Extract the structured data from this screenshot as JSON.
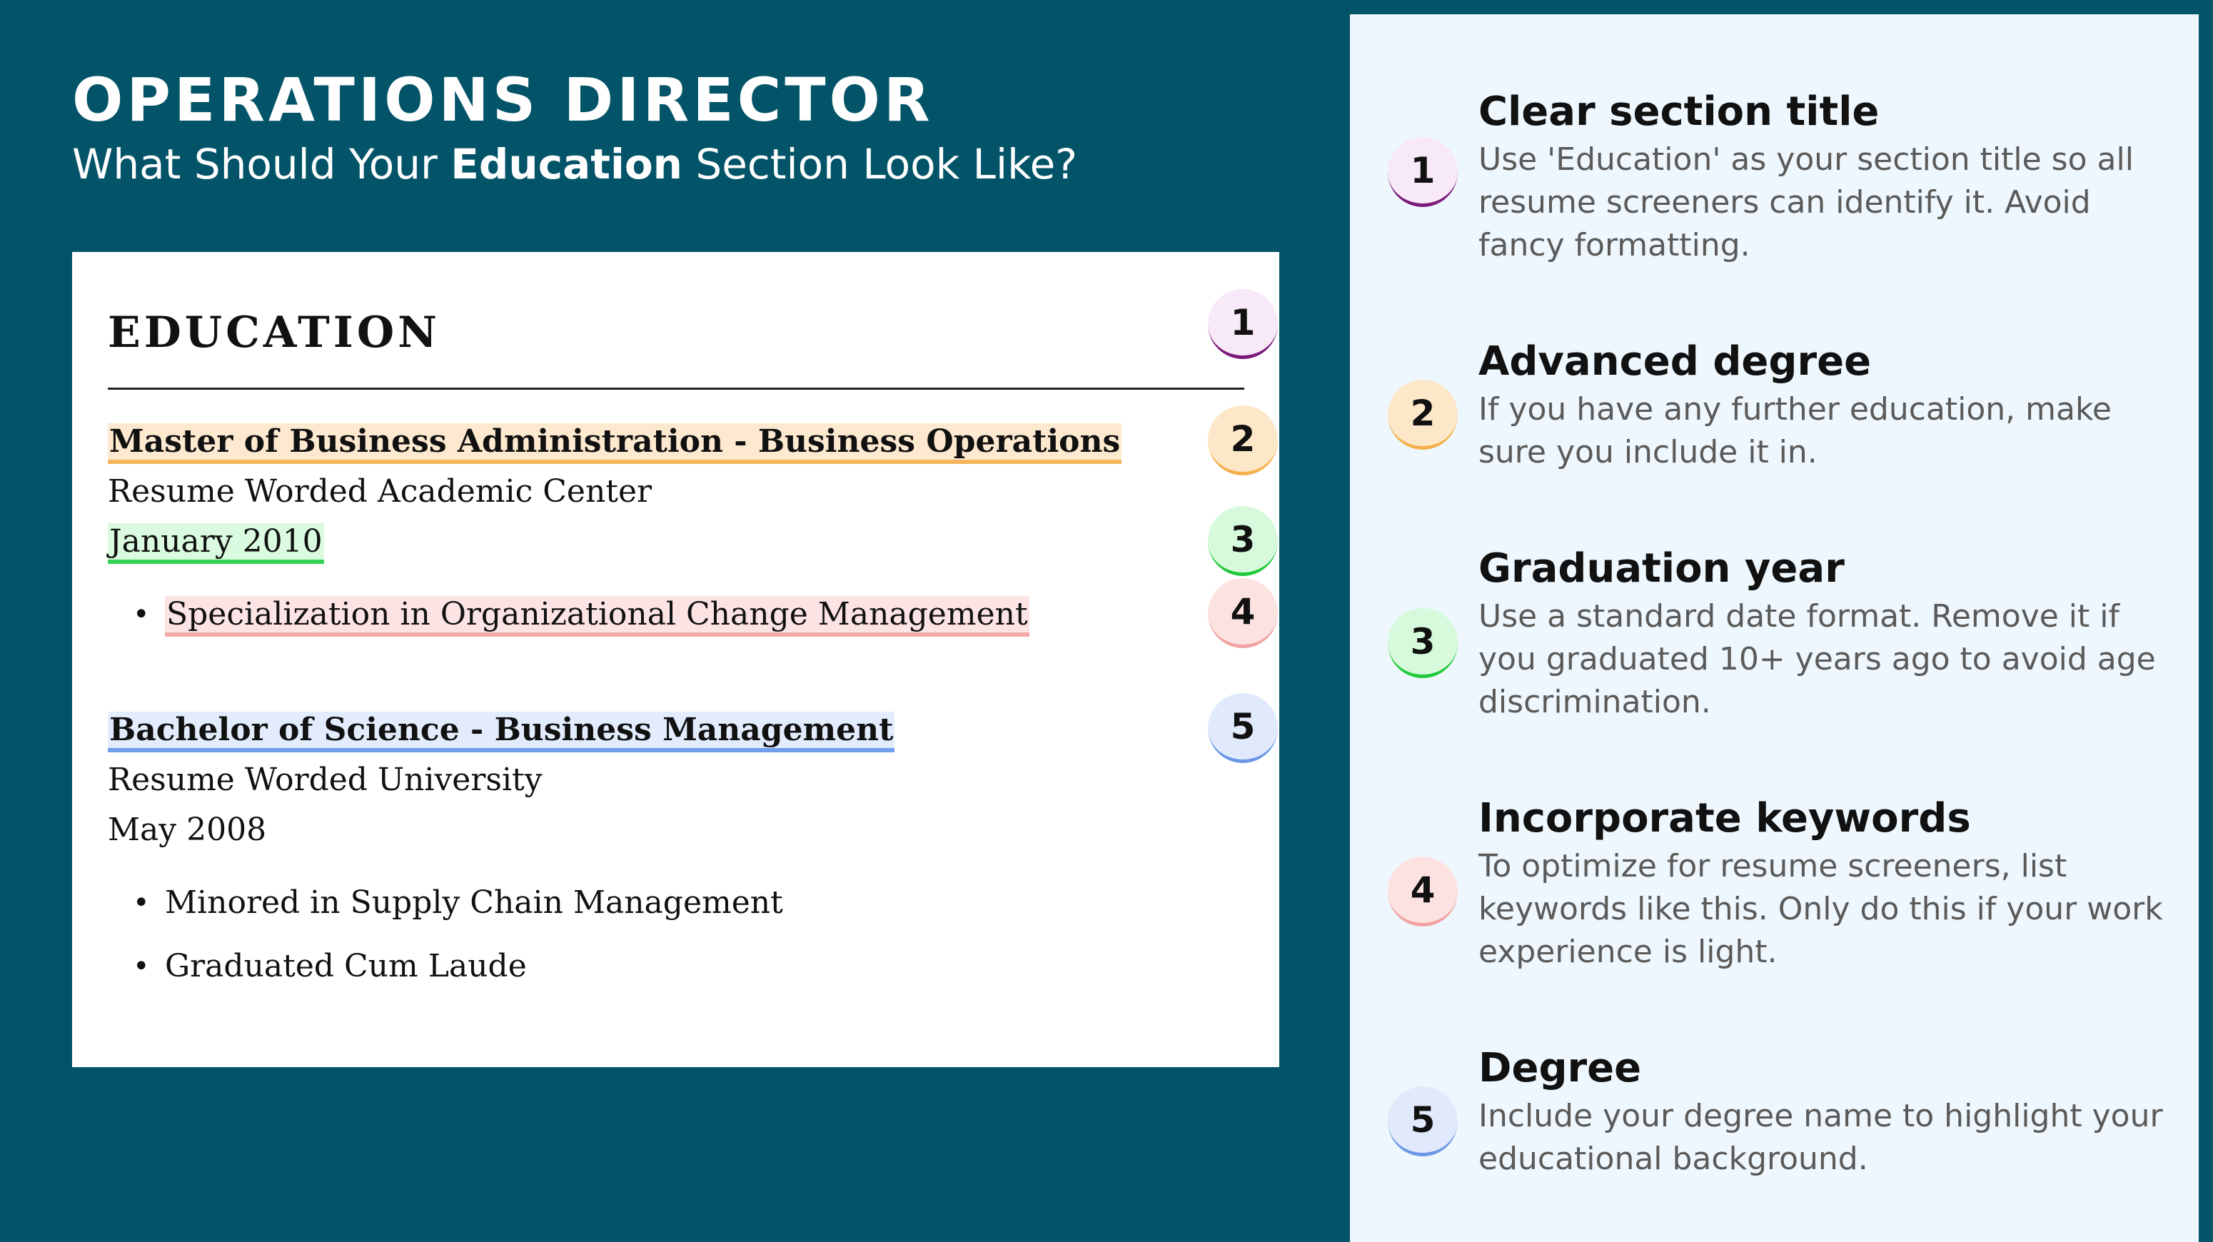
{
  "header": {
    "job_title": "OPERATIONS DIRECTOR",
    "subtitle_before": "What Should Your ",
    "subtitle_bold": "Education",
    "subtitle_after": " Section Look Like?"
  },
  "resume": {
    "section_heading": "EDUCATION",
    "entries": [
      {
        "degree": "Master of Business Administration - Business Operations",
        "school": "Resume Worded Academic Center",
        "date": "January 2010",
        "bullets": [
          "Specialization in Organizational Change Management"
        ]
      },
      {
        "degree": "Bachelor of Science - Business Management",
        "school": "Resume Worded University",
        "date": "May 2008",
        "bullets": [
          "Minored in Supply Chain Management",
          "Graduated Cum Laude"
        ]
      }
    ],
    "markers": [
      "1",
      "2",
      "3",
      "4",
      "5"
    ],
    "bullet_glyph": "•"
  },
  "tips": [
    {
      "number": "1",
      "title": "Clear section title",
      "description": "Use 'Education' as your section title so all resume screeners can identify it. Avoid fancy formatting."
    },
    {
      "number": "2",
      "title": "Advanced degree",
      "description": "If you have any further education, make sure you include it in."
    },
    {
      "number": "3",
      "title": "Graduation year",
      "description": "Use a standard date format. Remove it if you graduated 10+ years ago to avoid age discrimination."
    },
    {
      "number": "4",
      "title": "Incorporate keywords",
      "description": "To optimize for resume screeners, list keywords like this. Only do this if your work experience is light."
    },
    {
      "number": "5",
      "title": "Degree",
      "description": "Include your degree name to highlight your educational background."
    }
  ],
  "colors": {
    "background": "#035468",
    "panel": "#eef7fd",
    "highlight_1": "#7a1a7a",
    "highlight_2": "#f5b04c",
    "highlight_3": "#22c93c",
    "highlight_4": "#f3a2a2",
    "highlight_5": "#6a98e6"
  }
}
